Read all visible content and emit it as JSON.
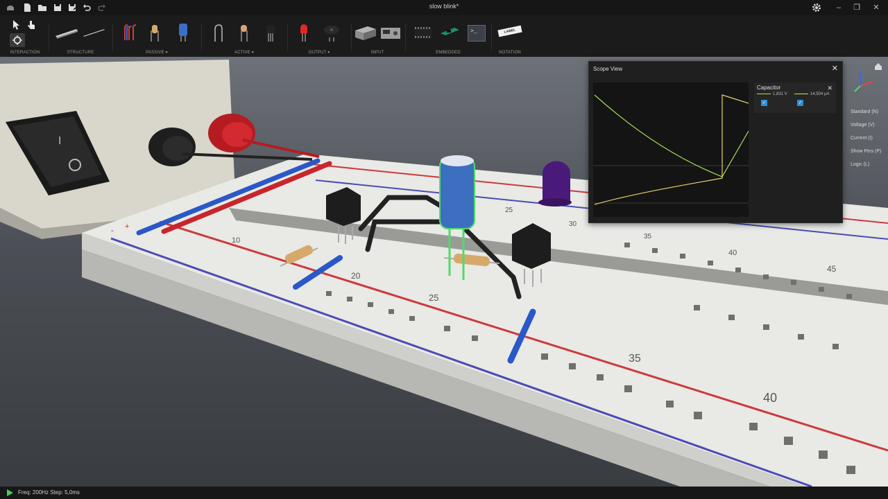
{
  "app": {
    "title": "slow blink*"
  },
  "toolbar": {
    "groups": [
      {
        "label": "INTERACTION"
      },
      {
        "label": "STRUCTURE"
      },
      {
        "label": "PASSIVE ▾"
      },
      {
        "label": "ACTIVE ▾"
      },
      {
        "label": "OUTPUT ▾"
      },
      {
        "label": "INPUT"
      },
      {
        "label": "EMBEDDED"
      },
      {
        "label": "NOTATION"
      }
    ],
    "notation_tool": "LABEL"
  },
  "scope": {
    "title": "Scope View",
    "legend": {
      "title": "Capacitor",
      "series": [
        {
          "value": "1,831 V",
          "color": "#a8e05a"
        },
        {
          "value": "14,504 µA",
          "color": "#e8d36a"
        }
      ]
    }
  },
  "view_options": {
    "items": [
      {
        "label": "Standard (N)",
        "checked": true
      },
      {
        "label": "Voltage (V)",
        "checked": false
      },
      {
        "label": "Current (I)",
        "checked": false
      },
      {
        "label": "Show Pins (P)",
        "checked": false
      },
      {
        "label": "Logic (L)",
        "checked": false
      }
    ]
  },
  "breadboard": {
    "numbers": [
      "10",
      "20",
      "25",
      "35",
      "40",
      "25",
      "30",
      "35",
      "40",
      "45"
    ],
    "rail_signs": [
      "-",
      "+"
    ]
  },
  "status": {
    "text": "Freq: 200Hz  Step: 5,0ms"
  },
  "colors": {
    "accent": "#2f8fd6",
    "play": "#3fd25a"
  }
}
